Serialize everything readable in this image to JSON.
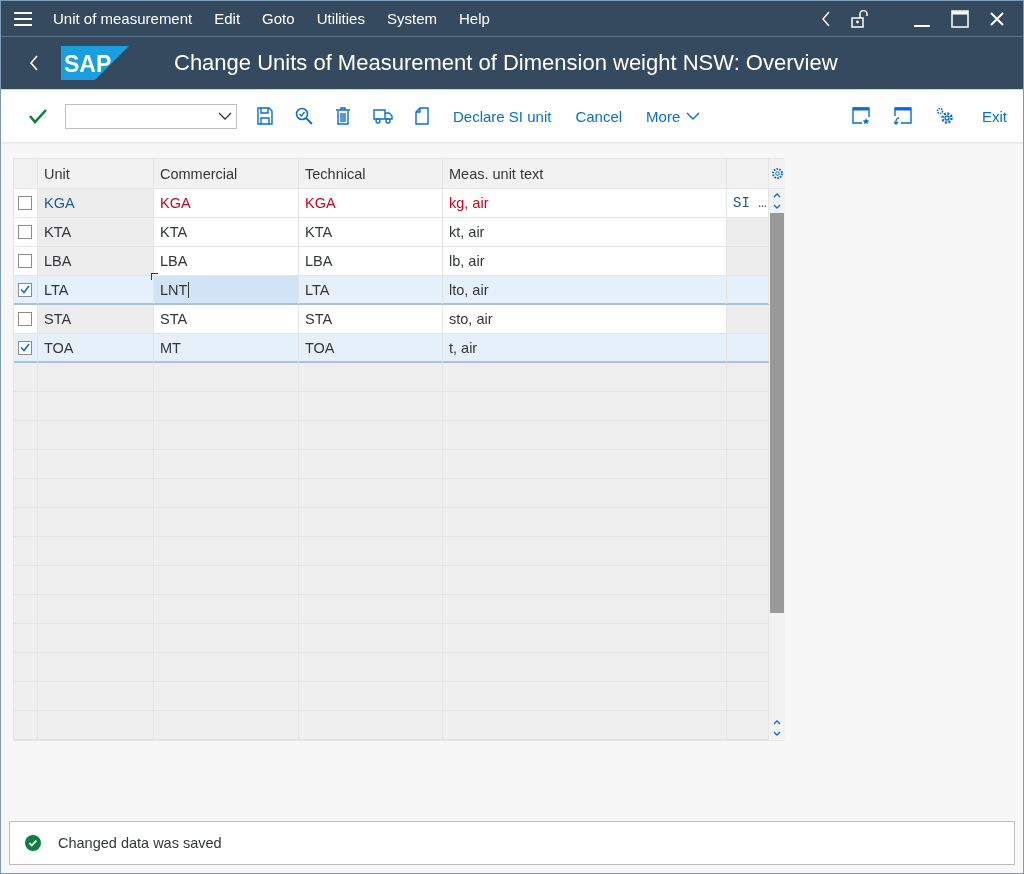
{
  "menu_bar": {
    "items": [
      "Unit of measurement",
      "Edit",
      "Goto",
      "Utilities",
      "System",
      "Help"
    ]
  },
  "title_bar": {
    "logo": "SAP",
    "title": "Change Units of Measurement of Dimension weight NSW: Overview"
  },
  "toolbar": {
    "buttons": [
      "Declare SI unit",
      "Cancel",
      "More"
    ],
    "exit": "Exit"
  },
  "table": {
    "columns": [
      "Unit",
      "Commercial",
      "Technical",
      "Meas. unit text"
    ],
    "rows": [
      {
        "unit": "KGA",
        "commercial": "KGA",
        "technical": "KGA",
        "text": "kg, air",
        "column_5": "SI …",
        "selected": false,
        "error": true,
        "focused": false
      },
      {
        "unit": "KTA",
        "commercial": "KTA",
        "technical": "KTA",
        "text": "kt, air",
        "selected": false,
        "error": false,
        "focused": false
      },
      {
        "unit": "LBA",
        "commercial": "LBA",
        "technical": "LBA",
        "text": "lb, air",
        "selected": false,
        "error": false,
        "focused": false
      },
      {
        "unit": "LTA",
        "commercial": "LNT",
        "technical": "LTA",
        "text": "lto, air",
        "selected": true,
        "error": false,
        "focused": true
      },
      {
        "unit": "STA",
        "commercial": "STA",
        "technical": "STA",
        "text": "sto, air",
        "selected": false,
        "error": false,
        "focused": false
      },
      {
        "unit": "TOA",
        "commercial": "MT",
        "technical": "TOA",
        "text": "t, air",
        "selected": true,
        "error": false,
        "focused": false
      }
    ]
  },
  "status_bar": {
    "kind": "success",
    "message": "Changed data was saved"
  }
}
